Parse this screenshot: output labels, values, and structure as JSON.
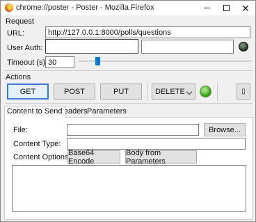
{
  "window": {
    "title": "chrome://poster - Poster - Mozilla Firefox",
    "icons": {
      "app": "firefox-icon",
      "minimize": "minimize-icon",
      "maximize": "maximize-icon",
      "close": "close-icon"
    }
  },
  "request": {
    "section_title": "Request",
    "url_label": "URL:",
    "url_value": "http://127.0.0.1:8000/polls/questions",
    "user_auth_label": "User Auth:",
    "user_value": "",
    "password_value": "",
    "auth_icon": "status-light-icon",
    "timeout_label": "Timeout (s):",
    "timeout_value": "30",
    "timeout_slider_fraction": 0.1
  },
  "actions": {
    "section_title": "Actions",
    "get_label": "GET",
    "post_label": "POST",
    "put_label": "PUT",
    "method_selected": "DELETE",
    "status_icon": "green-status-icon",
    "save_icon": "save-icon",
    "save_glyph": "▯"
  },
  "tabs": [
    {
      "label": "Content to Send",
      "active": true
    },
    {
      "label": "Headers",
      "active": false
    },
    {
      "label": "Parameters",
      "active": false
    }
  ],
  "content": {
    "file_label": "File:",
    "file_value": "",
    "browse_label": "Browse...",
    "content_type_label": "Content Type:",
    "content_type_value": "",
    "content_options_label": "Content Options:",
    "base64_label": "Base64 Encode",
    "body_from_params_label": "Body from Parameters",
    "body_value": ""
  },
  "colors": {
    "accent": "#0078d7",
    "status_green": "#3ea51f"
  }
}
